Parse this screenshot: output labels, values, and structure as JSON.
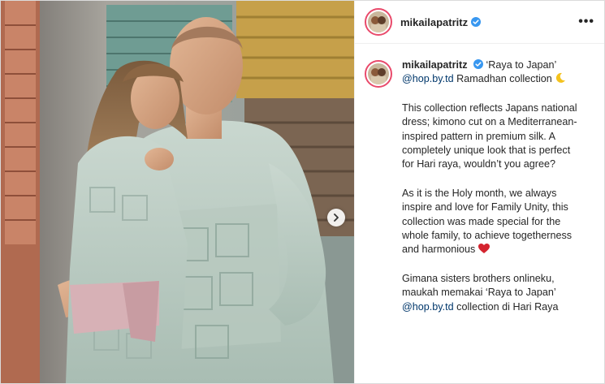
{
  "post": {
    "username": "mikailapatritz",
    "more_label": "•••",
    "caption": {
      "username": "mikailapatritz",
      "title": "‘Raya to Japan’",
      "mention1": "@hop.by.td",
      "line1_rest": " Ramadhan collection ",
      "para2": "This collection reflects Japans national dress; kimono cut on a Mediterranean- inspired pattern in premium silk. A completely unique look that is perfect for Hari raya, wouldn’t you agree?",
      "para3": "As it is the Holy month, we always inspire and love for Family Unity, this collection was made special for the whole family, to achieve togetherness and harmonious ",
      "para4_text": "Gimana sisters brothers onlineku, maukah memakai ‘Raya to Japan’",
      "mention2": "@hop.by.td",
      "para4_rest": " collection di Hari Raya"
    },
    "icons": {
      "verified": "verified-badge-icon",
      "moon": "crescent-moon-emoji",
      "heart": "heart-emoji",
      "next": "chevron-right-icon"
    },
    "colors": {
      "verified": "#3897f0",
      "mention": "#00376b",
      "avatar_ring": "#e94a6b"
    }
  }
}
